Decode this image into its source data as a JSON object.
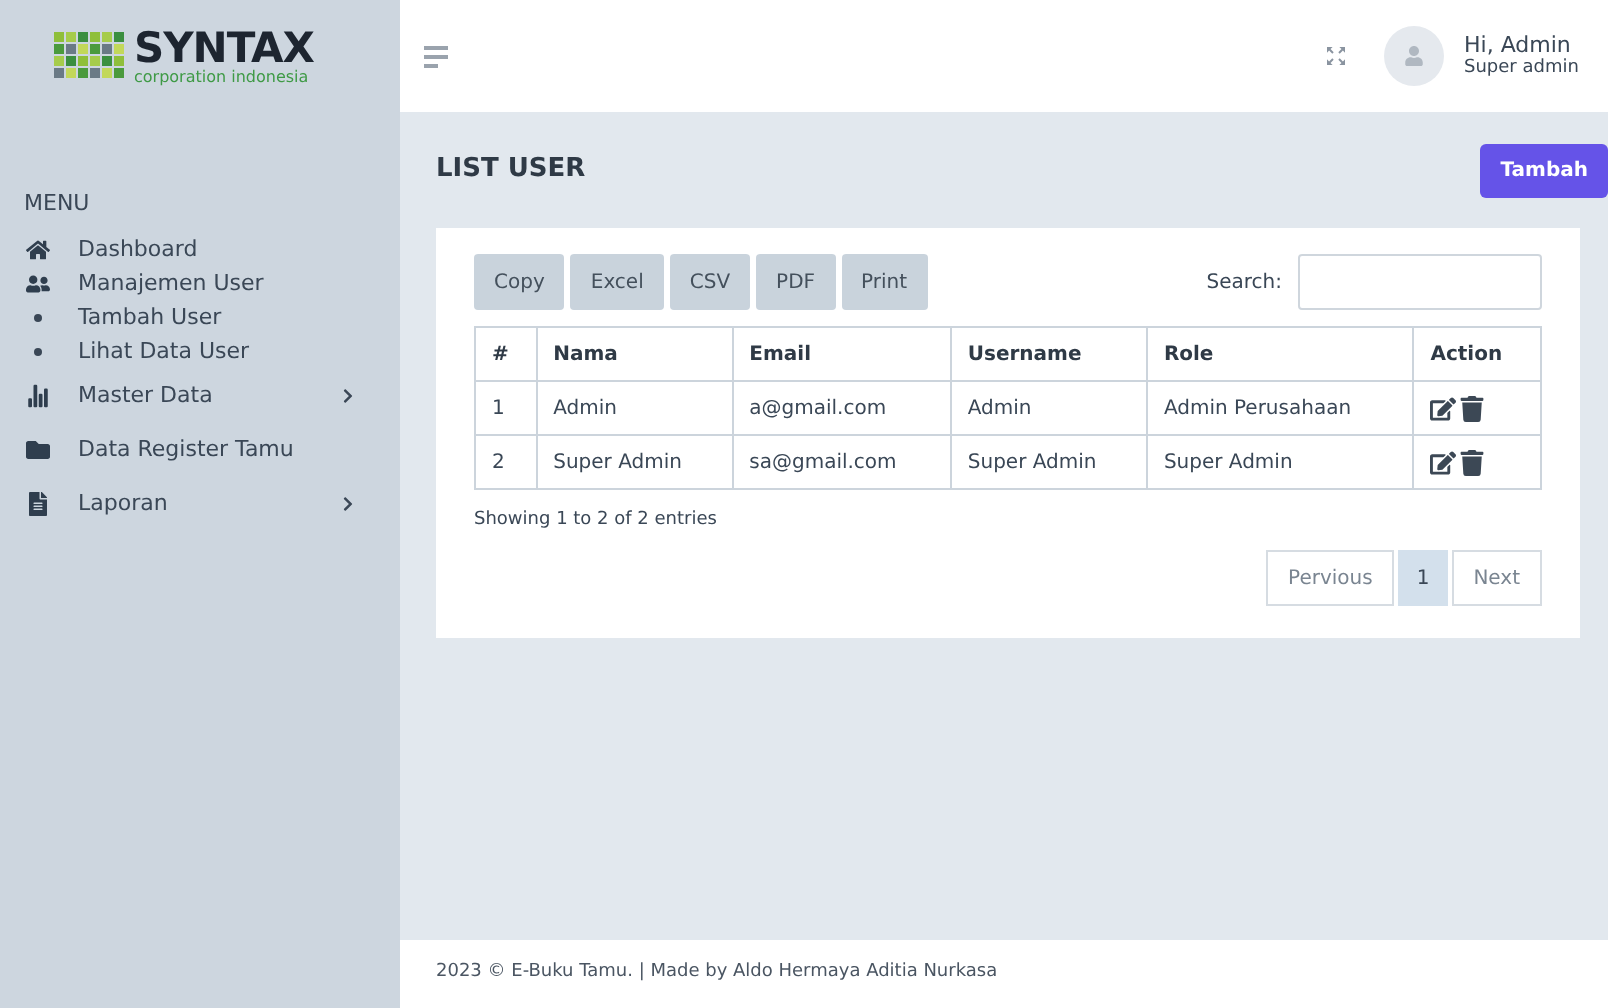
{
  "brand": {
    "name": "SYNTAX",
    "tagline": "corporation indonesia"
  },
  "user": {
    "greeting": "Hi, Admin",
    "role": "Super admin"
  },
  "sidebar": {
    "heading": "MENU",
    "items": [
      {
        "label": "Dashboard",
        "kind": "home",
        "expandable": false
      },
      {
        "label": "Manajemen User",
        "kind": "users",
        "expandable": false
      },
      {
        "label": "Tambah User",
        "kind": "bullet",
        "expandable": false
      },
      {
        "label": "Lihat Data User",
        "kind": "bullet",
        "expandable": false
      },
      {
        "label": "Master Data",
        "kind": "chart",
        "expandable": true
      },
      {
        "label": "Data Register Tamu",
        "kind": "folder",
        "expandable": false
      },
      {
        "label": "Laporan",
        "kind": "file",
        "expandable": true
      }
    ]
  },
  "page": {
    "title": "LIST USER",
    "add_button": "Tambah"
  },
  "export_buttons": [
    "Copy",
    "Excel",
    "CSV",
    "PDF",
    "Print"
  ],
  "search": {
    "label": "Search:"
  },
  "table": {
    "columns": [
      "#",
      "Nama",
      "Email",
      "Username",
      "Role",
      "Action"
    ],
    "rows": [
      [
        "1",
        "Admin",
        "a@gmail.com",
        "Admin",
        "Admin Perusahaan"
      ],
      [
        "2",
        "Super Admin",
        "sa@gmail.com",
        "Super Admin",
        "Super Admin"
      ]
    ]
  },
  "info": "Showing 1 to 2 of 2 entries",
  "pagination": {
    "previous": "Pervious",
    "pages": [
      {
        "label": "1",
        "selected": true
      }
    ],
    "next": "Next"
  },
  "footer": "2023 © E-Buku Tamu. | Made by Aldo Hermaya Aditia Nurkasa"
}
